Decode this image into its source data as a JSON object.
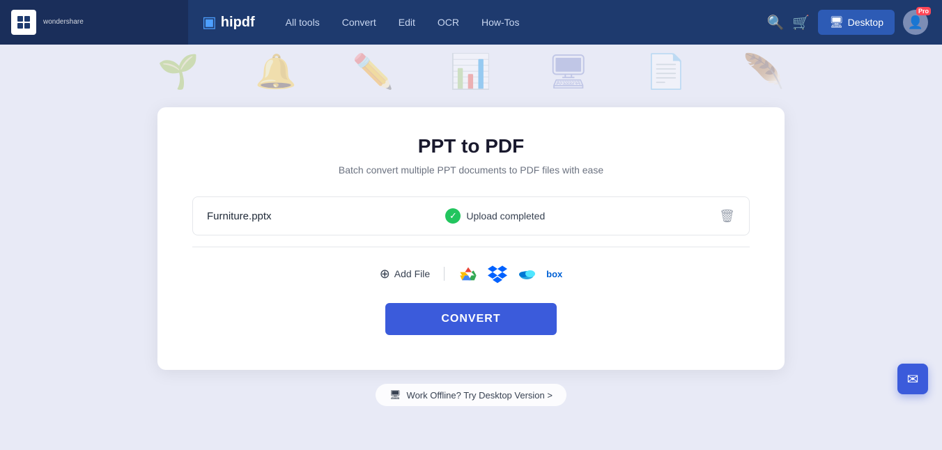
{
  "brand": {
    "wondershare": "wondershare",
    "hipdf": "hipdf"
  },
  "nav": {
    "links": [
      {
        "label": "All tools",
        "id": "all-tools"
      },
      {
        "label": "Convert",
        "id": "convert"
      },
      {
        "label": "Edit",
        "id": "edit"
      },
      {
        "label": "OCR",
        "id": "ocr"
      },
      {
        "label": "How-Tos",
        "id": "how-tos"
      }
    ],
    "desktop_btn": "Desktop",
    "pro_badge": "Pro"
  },
  "page": {
    "title": "PPT to PDF",
    "subtitle": "Batch convert multiple PPT documents to PDF files with ease"
  },
  "file": {
    "name": "Furniture.pptx",
    "status": "Upload completed"
  },
  "actions": {
    "add_file": "Add File",
    "convert": "CONVERT"
  },
  "footer": {
    "offline_text": "Work Offline? Try Desktop Version >"
  }
}
